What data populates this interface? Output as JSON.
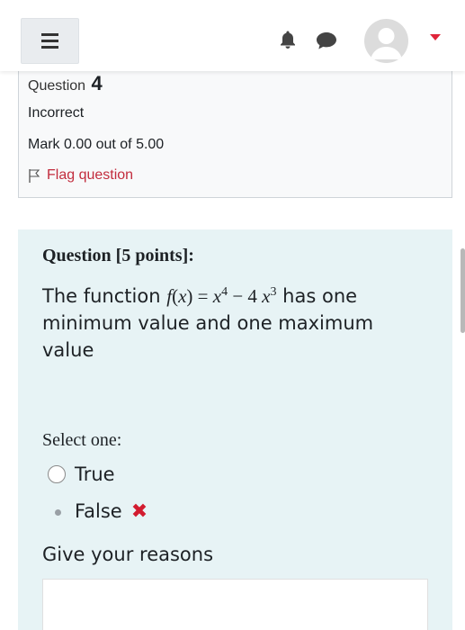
{
  "navbar": {
    "menu_icon": "hamburger-icon",
    "notification_icon": "bell-icon",
    "messages_icon": "chat-icon",
    "user_icon": "avatar",
    "dropdown_icon": "caret-down-icon",
    "accent_color": "#e0243a"
  },
  "info": {
    "question_label": "Question",
    "question_number": "4",
    "state": "Incorrect",
    "grade": "Mark 0.00 out of 5.00",
    "flag_label": "Flag question",
    "flag_color": "#c22c3d"
  },
  "question": {
    "title": "Question [5 points]:",
    "text_before": "The function",
    "text_after": "has one minimum value and one maximum value",
    "select_prompt": "Select one:",
    "options": [
      {
        "label": "True",
        "selected": false
      },
      {
        "label": "False",
        "selected": true,
        "feedback": "incorrect"
      }
    ],
    "incorrect_mark": "✖",
    "reasons_label": "Give your reasons",
    "reasons_value": "",
    "background": "#e7f3f5"
  }
}
